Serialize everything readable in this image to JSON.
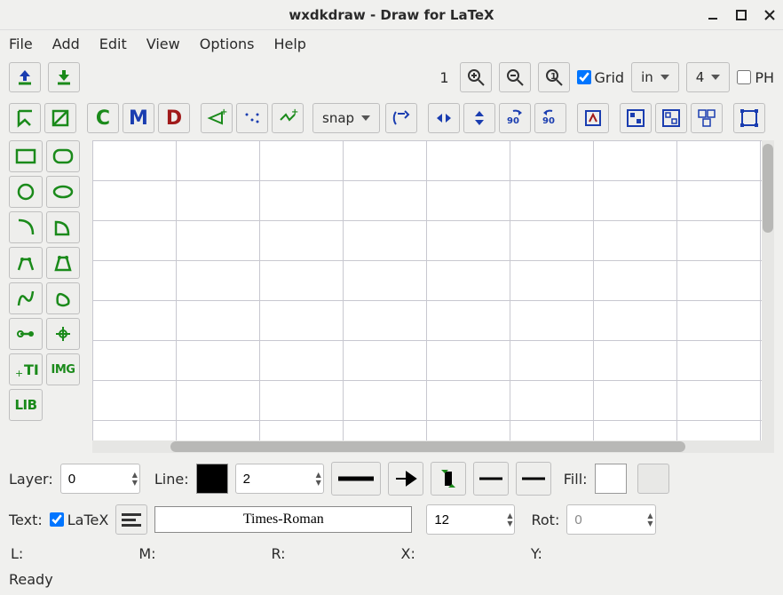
{
  "window": {
    "title": "wxdkdraw - Draw for LaTeX"
  },
  "menu": {
    "file": "File",
    "add": "Add",
    "edit": "Edit",
    "view": "View",
    "options": "Options",
    "help": "Help"
  },
  "zoom": {
    "number": "1"
  },
  "grid": {
    "label": "Grid",
    "checked": true,
    "unit": "in",
    "divs": "4"
  },
  "ph": {
    "label": "PH",
    "checked": false
  },
  "snap": {
    "label": "snap"
  },
  "props": {
    "layer_label": "Layer:",
    "layer_value": "0",
    "line_label": "Line:",
    "line_color": "#000000",
    "line_width": "2",
    "fill_label": "Fill:",
    "fill_color": "#ffffff"
  },
  "text": {
    "label": "Text:",
    "latex_label": "LaTeX",
    "latex_checked": true,
    "font": "Times-Roman",
    "size": "12",
    "rot_label": "Rot:",
    "rot_value": "0"
  },
  "coords": {
    "L": "L:",
    "M": "M:",
    "R": "R:",
    "X": "X:",
    "Y": "Y:"
  },
  "status": "Ready"
}
